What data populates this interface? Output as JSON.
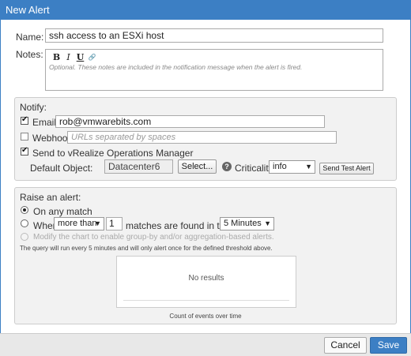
{
  "dialog": {
    "title": "New Alert"
  },
  "form": {
    "name_label": "Name:",
    "name_value": "ssh access to an ESXi host",
    "notes_label": "Notes:",
    "notes_toolbar": {
      "bold": "B",
      "italic": "I",
      "underline": "U",
      "link": "🔗"
    },
    "notes_placeholder": "Optional. These notes are included in the notification message when the alert is fired."
  },
  "notify": {
    "heading": "Notify:",
    "email_label": "Email:",
    "email_checked": true,
    "email_value": "rob@vmwarebits.com",
    "webhook_label": "Webhook:",
    "webhook_checked": false,
    "webhook_placeholder": "URLs separated by spaces",
    "vrops_label": "Send to vRealize Operations Manager",
    "vrops_checked": true,
    "default_object_label": "Default Object:",
    "default_object_value": "Datacenter6",
    "select_button": "Select...",
    "help_icon": "?",
    "criticality_label": "Criticality:",
    "criticality_value": "info",
    "test_button": "Send Test Alert"
  },
  "raise": {
    "heading": "Raise an alert:",
    "on_any_match_label": "On any match",
    "on_any_match_selected": true,
    "when_label": "When",
    "when_operator": "more than",
    "when_count": "1",
    "matches_text": "matches are found in the last",
    "time_window": "5 Minutes",
    "groupby_label": "Modify the chart to enable group-by and/or aggregation-based alerts.",
    "query_info": "The query will run every 5 minutes and will only alert once for the defined threshold above.",
    "chart_empty": "No results",
    "chart_caption": "Count of events over time"
  },
  "footer": {
    "cancel": "Cancel",
    "save": "Save"
  },
  "colors": {
    "title_bar": "#3c7fc4",
    "save_button": "#3c7fc4"
  }
}
